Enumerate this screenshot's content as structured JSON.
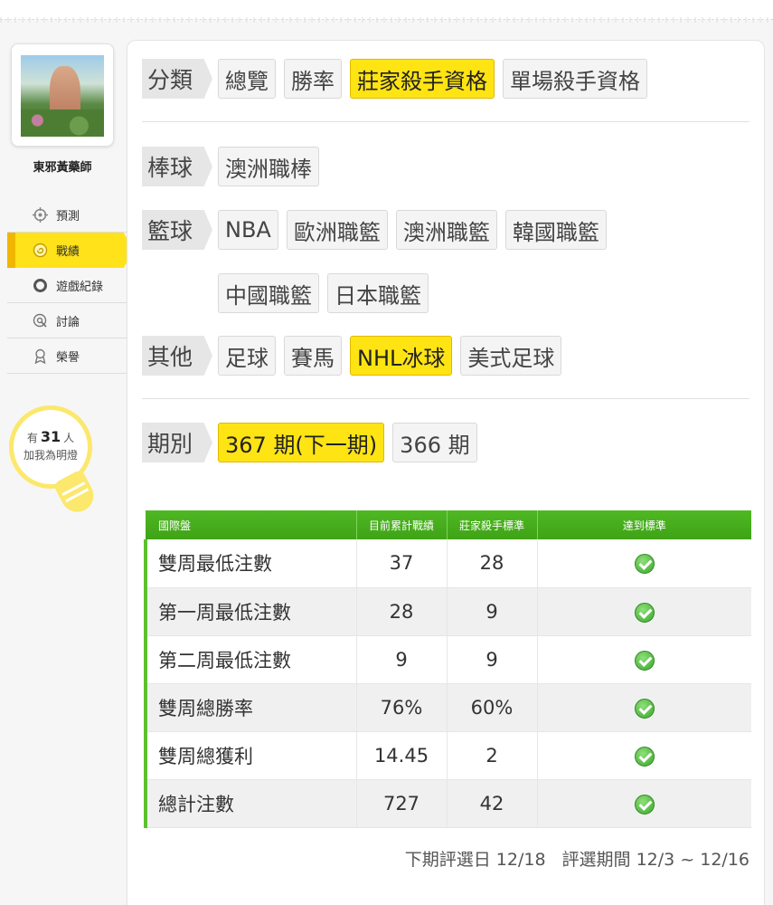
{
  "user": {
    "name": "東邪黃藥師"
  },
  "menu": [
    {
      "label": "預測",
      "icon": "crosshair-icon"
    },
    {
      "label": "戰績",
      "icon": "spiral-icon"
    },
    {
      "label": "遊戲紀錄",
      "icon": "ring-icon"
    },
    {
      "label": "討論",
      "icon": "chat-search-icon"
    },
    {
      "label": "榮譽",
      "icon": "medal-icon"
    }
  ],
  "fans": {
    "prefix": "有",
    "count": "31",
    "suffix": "人",
    "line2": "加我為明燈"
  },
  "filters": {
    "category": {
      "label": "分類",
      "options": [
        "總覽",
        "勝率",
        "莊家殺手資格",
        "單場殺手資格"
      ],
      "selected": "莊家殺手資格"
    },
    "baseball": {
      "label": "棒球",
      "options": [
        "澳洲職棒"
      ]
    },
    "basketball": {
      "label": "籃球",
      "options": [
        "NBA",
        "歐洲職籃",
        "澳洲職籃",
        "韓國職籃",
        "中國職籃",
        "日本職籃"
      ]
    },
    "other": {
      "label": "其他",
      "options": [
        "足球",
        "賽馬",
        "NHL冰球",
        "美式足球"
      ],
      "selected": "NHL冰球"
    },
    "period": {
      "label": "期別",
      "options": [
        "367 期(下一期)",
        "366 期"
      ],
      "selected": "367 期(下一期)"
    }
  },
  "table": {
    "headers": [
      "國際盤",
      "目前累計戰績",
      "莊家殺手標準",
      "達到標準"
    ],
    "rows": [
      {
        "label": "雙周最低注數",
        "current": "37",
        "standard": "28",
        "met": true
      },
      {
        "label": "第一周最低注數",
        "current": "28",
        "standard": "9",
        "met": true
      },
      {
        "label": "第二周最低注數",
        "current": "9",
        "standard": "9",
        "met": true
      },
      {
        "label": "雙周總勝率",
        "current": "76%",
        "standard": "60%",
        "met": true
      },
      {
        "label": "雙周總獲利",
        "current": "14.45",
        "standard": "2",
        "met": true
      },
      {
        "label": "總計注數",
        "current": "727",
        "standard": "42",
        "met": true
      }
    ]
  },
  "footer": {
    "next_date": "下期評選日 12/18",
    "range": "評選期間 12/3 ~ 12/16"
  },
  "colors": {
    "accent_yellow": "#ffe413",
    "header_green": "#4eb823",
    "check_green": "#3aa52c"
  }
}
